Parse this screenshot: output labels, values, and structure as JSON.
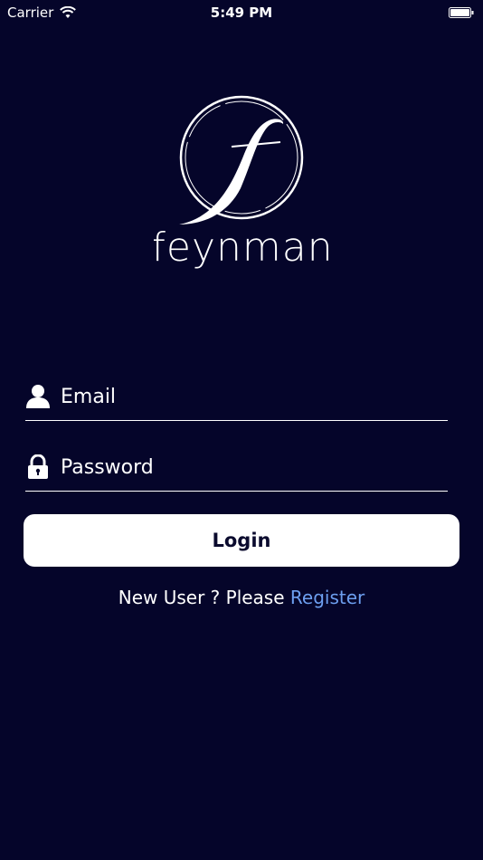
{
  "status_bar": {
    "carrier": "Carrier",
    "time": "5:49 PM"
  },
  "brand": {
    "name": "feynman"
  },
  "form": {
    "email_placeholder": "Email",
    "password_placeholder": "Password"
  },
  "actions": {
    "login_label": "Login",
    "register_prompt": "New User ? Please",
    "register_link": "Register"
  },
  "icons": {
    "wifi": "wifi-icon",
    "battery": "battery-icon",
    "user": "user-icon",
    "lock": "lock-icon"
  },
  "colors": {
    "background": "#05052a",
    "button": "#ffffff",
    "link": "#6d9ff0"
  }
}
